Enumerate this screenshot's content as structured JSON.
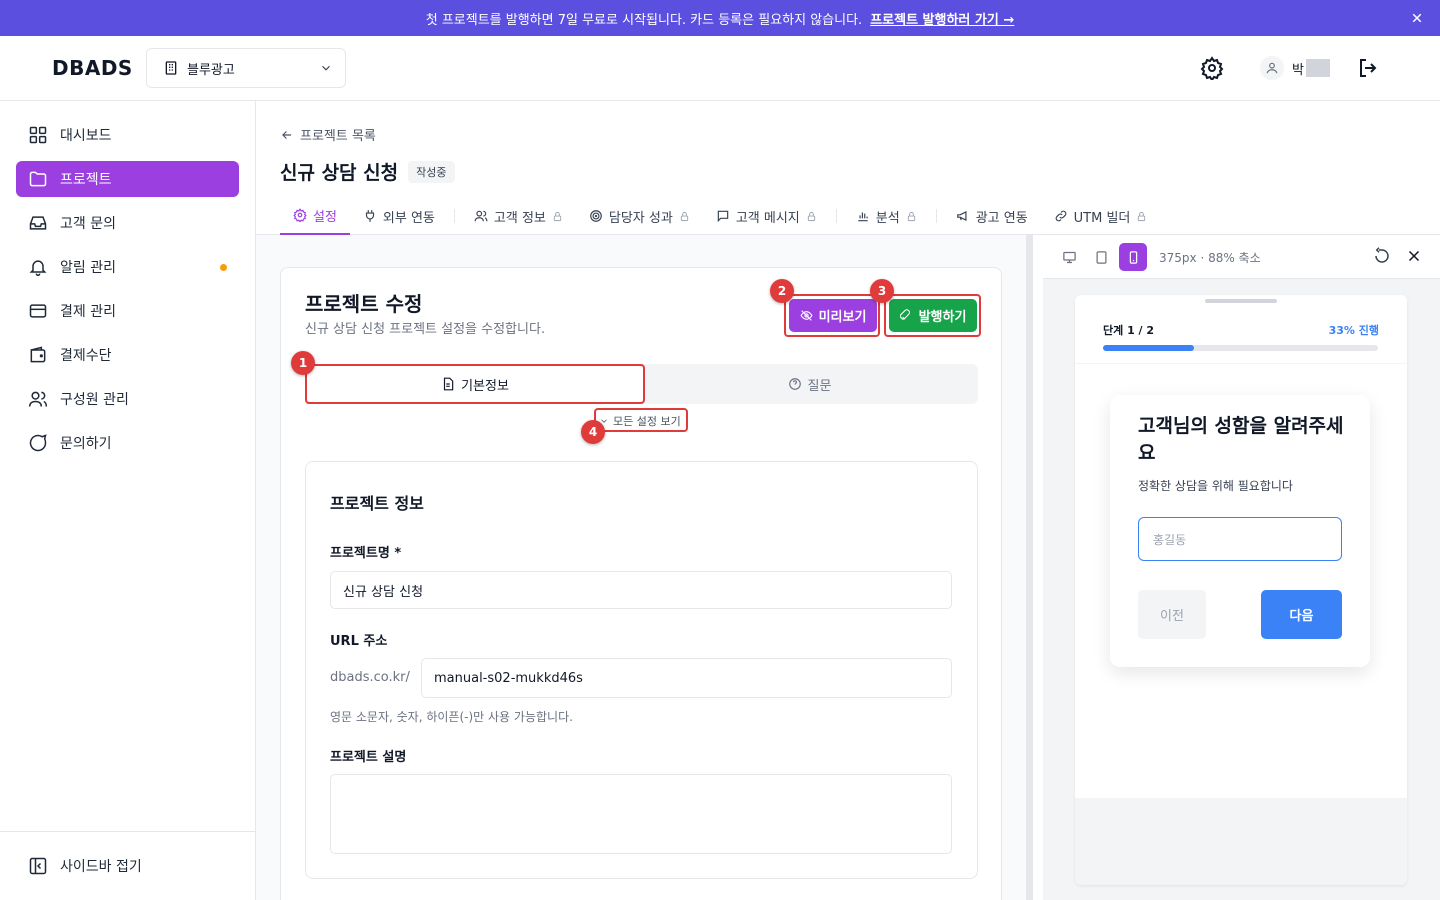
{
  "banner": {
    "text": "첫 프로젝트를 발행하면 7일 무료로 시작됩니다. 카드 등록은 필요하지 않습니다.",
    "link": "프로젝트 발행하러 가기 →",
    "bg_color": "#5b4fe0"
  },
  "header": {
    "logo": "DBADS",
    "workspace": "블루광고",
    "user_name": "박"
  },
  "sidebar": {
    "items": [
      {
        "label": "대시보드",
        "icon": "dashboard-icon"
      },
      {
        "label": "프로젝트",
        "icon": "folder-icon",
        "active": true
      },
      {
        "label": "고객 문의",
        "icon": "inbox-icon"
      },
      {
        "label": "알림 관리",
        "icon": "bell-icon",
        "dot": true
      },
      {
        "label": "결제 관리",
        "icon": "credit-card-icon"
      },
      {
        "label": "결제수단",
        "icon": "wallet-icon"
      },
      {
        "label": "구성원 관리",
        "icon": "users-icon"
      },
      {
        "label": "문의하기",
        "icon": "chat-icon"
      }
    ],
    "collapse_label": "사이드바 접기"
  },
  "page": {
    "back_label": "프로젝트 목록",
    "title": "신규 상담 신청",
    "status": "작성중"
  },
  "tabs": [
    {
      "label": "설정",
      "icon": "gear-icon",
      "active": true
    },
    {
      "label": "외부 연동",
      "icon": "plug-icon"
    },
    {
      "label": "고객 정보",
      "icon": "users-icon",
      "locked": true
    },
    {
      "label": "담당자 성과",
      "icon": "target-icon",
      "locked": true
    },
    {
      "label": "고객 메시지",
      "icon": "message-icon",
      "locked": true
    },
    {
      "label": "분석",
      "icon": "bar-chart-icon",
      "locked": true
    },
    {
      "label": "광고 연동",
      "icon": "megaphone-icon"
    },
    {
      "label": "UTM 빌더",
      "icon": "link-icon",
      "locked": true
    }
  ],
  "editor": {
    "title": "프로젝트 수정",
    "subtitle": "신규 상담 신청 프로젝트 설정을 수정합니다.",
    "preview_button": "미리보기",
    "publish_button": "발행하기",
    "seg_basic": "기본정보",
    "seg_questions": "질문",
    "show_all": "모든 설정 보기",
    "section_title": "프로젝트 정보",
    "name_label": "프로젝트명 *",
    "name_value": "신규 상담 신청",
    "url_label": "URL 주소",
    "url_prefix": "dbads.co.kr/",
    "url_value": "manual-s02-mukkd46s",
    "url_help": "영문 소문자, 숫자, 하이픈(-)만 사용 가능합니다.",
    "desc_label": "프로젝트 설명",
    "desc_value": ""
  },
  "annotations": [
    "1",
    "2",
    "3",
    "4"
  ],
  "preview": {
    "size_text": "375px · 88% 축소",
    "step_label": "단계 1 / 2",
    "progress_text": "33% 진행",
    "progress": 0.33,
    "question": "고객님의 성함을 알려주세요",
    "question_sub": "정확한 상담을 위해 필요합니다",
    "input_placeholder": "홍길동",
    "prev_button": "이전",
    "next_button": "다음"
  },
  "colors": {
    "accent": "#9b3fe0",
    "publish": "#16a34a",
    "annotation": "#e03b3b",
    "preview_accent": "#3b82f6"
  }
}
